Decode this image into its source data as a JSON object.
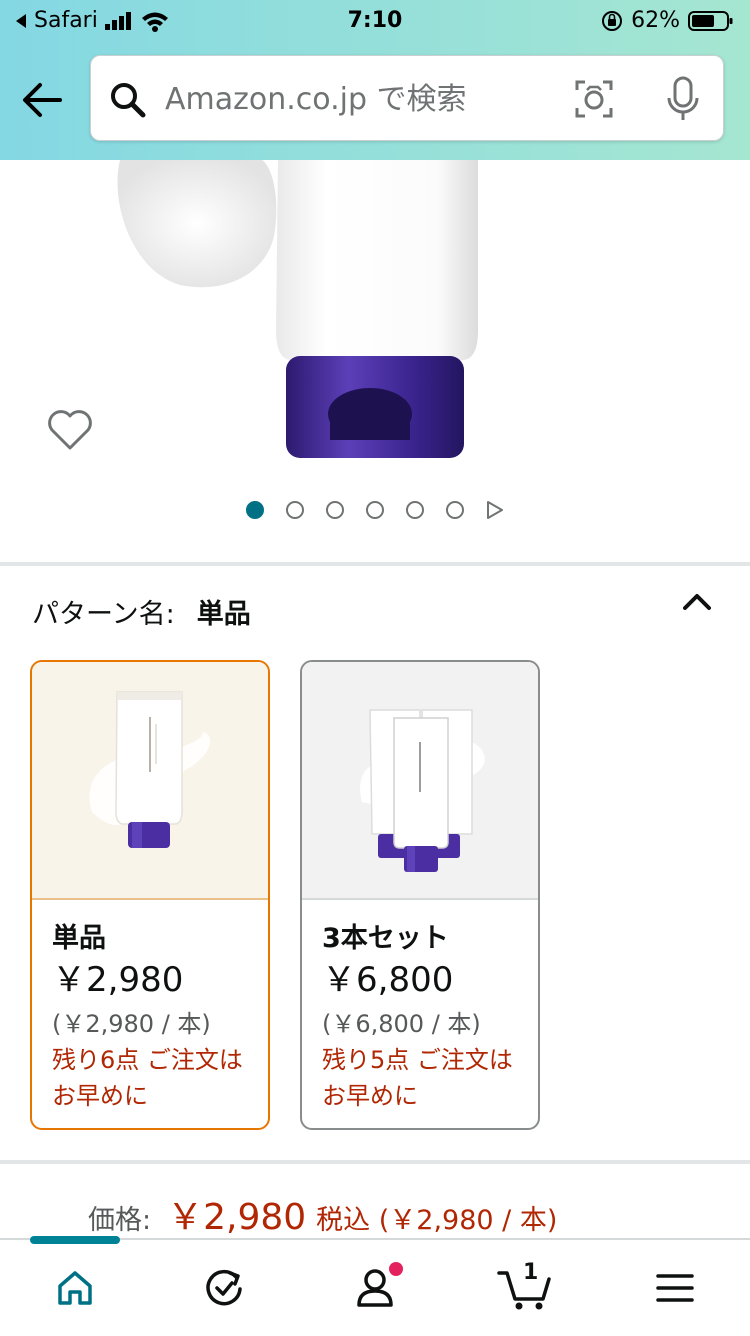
{
  "status_bar": {
    "back_app": "Safari",
    "time": "7:10",
    "battery_percent": "62%"
  },
  "search": {
    "placeholder": "Amazon.co.jp で検索"
  },
  "gallery": {
    "image_count": 6,
    "active_index": 0
  },
  "pattern": {
    "label": "パターン名:",
    "selected_value": "単品"
  },
  "options": [
    {
      "name": "単品",
      "price": "￥2,980",
      "unit_price": "(￥2,980 / 本)",
      "stock_note": "残り6点 ご注文はお早めに",
      "selected": true
    },
    {
      "name": "3本セット",
      "price": "￥6,800",
      "unit_price": "(￥6,800 / 本)",
      "stock_note": "残り5点 ご注文はお早めに",
      "selected": false
    }
  ],
  "price_summary": {
    "label": "価格:",
    "price": "￥2,980",
    "tax_note": "税込 (￥2,980 / 本)"
  },
  "tabbar": {
    "cart_count": "1",
    "active_tab": "home"
  },
  "colors": {
    "header_gradient_start": "#84d8e3",
    "header_gradient_end": "#a5e6d1",
    "accent_teal": "#007185",
    "price_red": "#b12704",
    "selected_border": "#e77600",
    "cap_purple": "#4a2d9c"
  }
}
